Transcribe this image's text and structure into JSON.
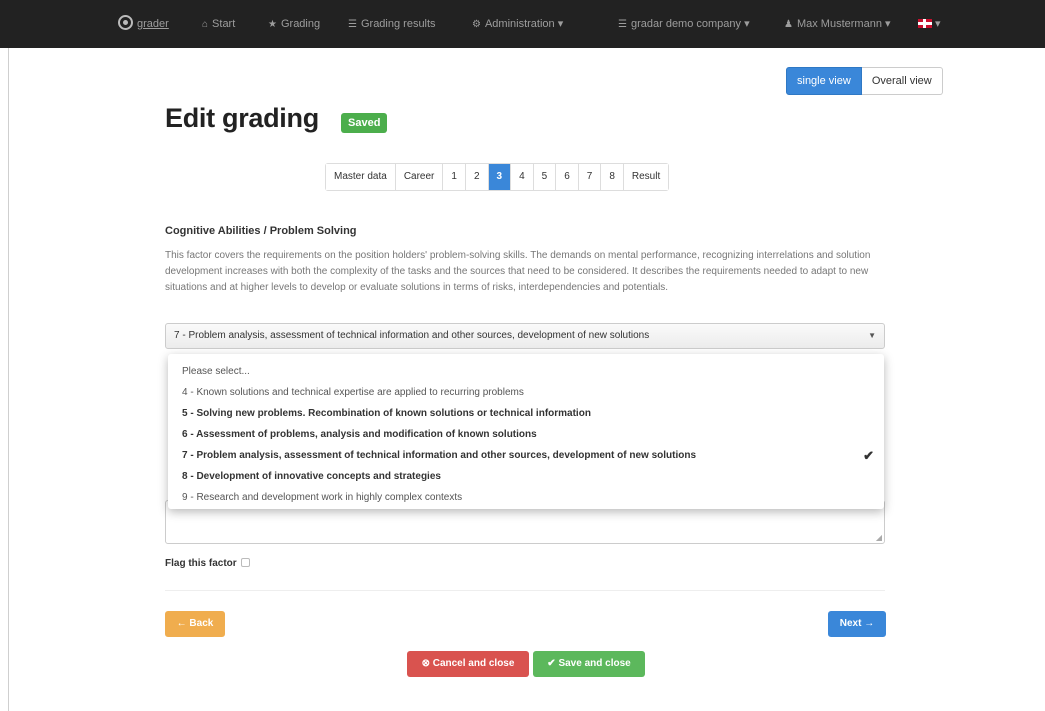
{
  "navbar": {
    "brand": "grader",
    "items": [
      {
        "icon": "home-icon",
        "glyph": "⌂",
        "label": "Start"
      },
      {
        "icon": "star-icon",
        "glyph": "★",
        "label": "Grading"
      },
      {
        "icon": "list-icon",
        "glyph": "☰",
        "label": "Grading results"
      },
      {
        "icon": "gear-icon",
        "glyph": "⚙",
        "label": "Administration ▾"
      },
      {
        "icon": "company-icon",
        "glyph": "☰",
        "label": "gradar demo company ▾"
      },
      {
        "icon": "user-icon",
        "glyph": "♟",
        "label": "Max Mustermann ▾"
      },
      {
        "icon": "flag-uk-icon",
        "glyph": "",
        "label": "▾"
      }
    ]
  },
  "view_toggle": {
    "single": "single view",
    "overall": "Overall view"
  },
  "page": {
    "title": "Edit grading",
    "status_badge": "Saved"
  },
  "pagination": {
    "pages": [
      "Master data",
      "Career",
      "1",
      "2",
      "3",
      "4",
      "5",
      "6",
      "7",
      "8",
      "Result"
    ],
    "active": "3"
  },
  "factor": {
    "title": "Cognitive Abilities / Problem Solving",
    "description": "This factor covers the requirements on the position holders' problem-solving skills. The demands on mental performance, recognizing interrelations and solution development increases with both the complexity of the tasks and the sources that need to be considered. It describes the requirements needed to adapt to new situations and at higher levels to develop or evaluate solutions in terms of risks, interdependencies and potentials.",
    "selected_value": "7 - Problem analysis, assessment of technical information and other sources, development of new solutions",
    "options": [
      {
        "label": "Please select...",
        "bold": false,
        "checked": false
      },
      {
        "label": "4 - Known solutions and technical expertise are applied to recurring problems",
        "bold": false,
        "checked": false
      },
      {
        "label": "5 - Solving new problems. Recombination of known solutions or technical information",
        "bold": true,
        "checked": false
      },
      {
        "label": "6 - Assessment of problems, analysis and modification of known solutions",
        "bold": true,
        "checked": false
      },
      {
        "label": "7 - Problem analysis, assessment of technical information and other sources, development of new solutions",
        "bold": true,
        "checked": true
      },
      {
        "label": "8 - Development of innovative concepts and strategies",
        "bold": true,
        "checked": false
      },
      {
        "label": "9 - Research and development work in highly complex contexts",
        "bold": false,
        "checked": false
      }
    ]
  },
  "flag_label": "Flag this factor",
  "buttons": {
    "back": "← Back",
    "next": "Next →",
    "cancel": "⊗ Cancel and close",
    "save": "✔ Save and close"
  },
  "colors": {
    "primary": "#3a87d9",
    "success": "#5cb85c",
    "danger": "#d9534f",
    "warning": "#f0ad4e",
    "navbar": "#222222"
  }
}
